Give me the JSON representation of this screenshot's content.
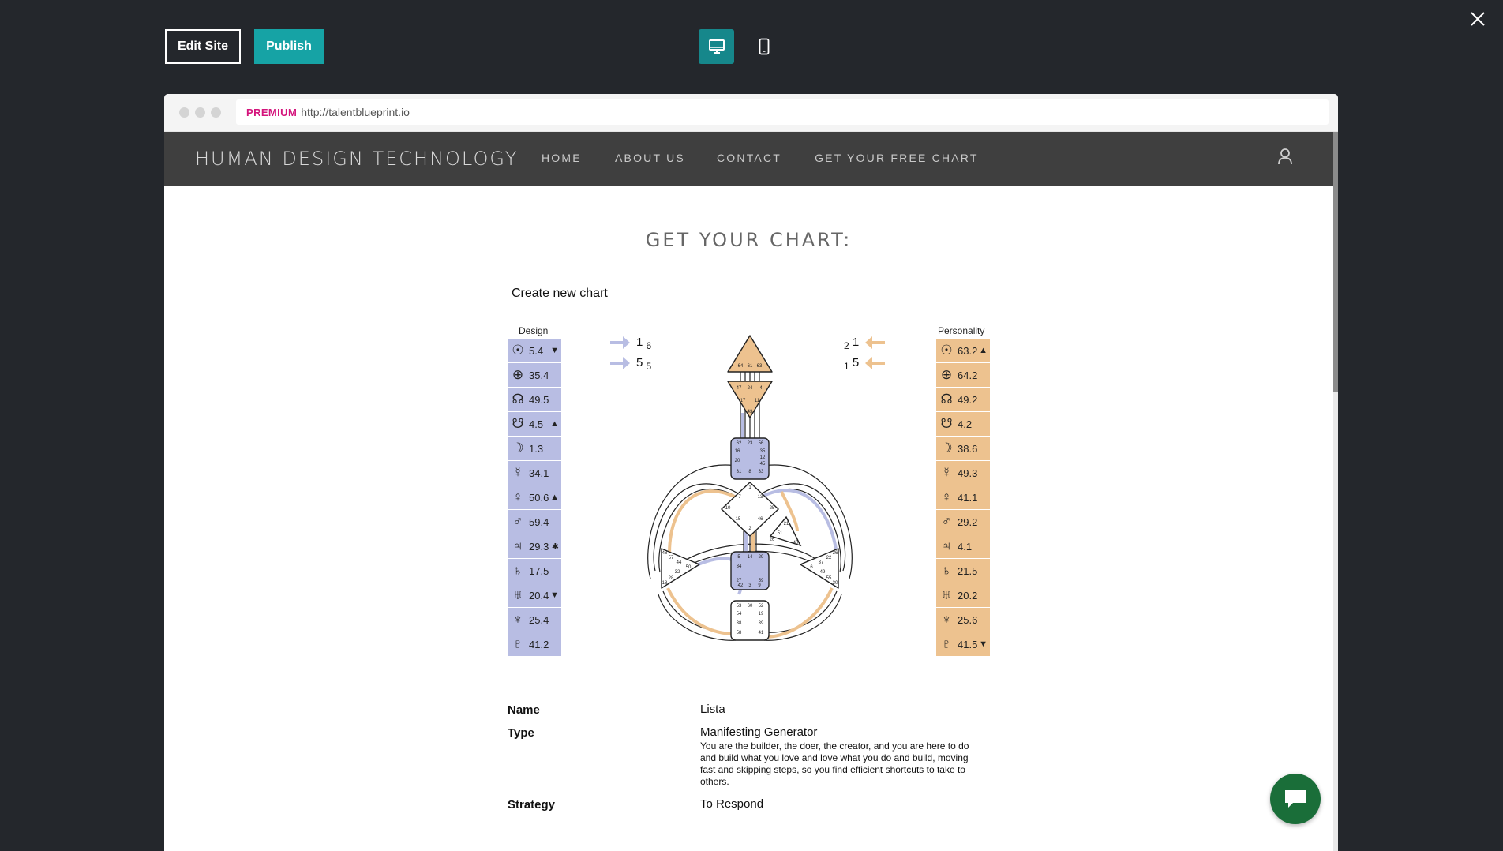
{
  "editor": {
    "edit_label": "Edit Site",
    "publish_label": "Publish",
    "desktop_icon": "desktop-icon",
    "mobile_icon": "mobile-icon",
    "close_icon": "close-icon"
  },
  "browser": {
    "badge": "PREMIUM",
    "url": "http://talentblueprint.io"
  },
  "site": {
    "brand": "HUMAN DESIGN TECHNOLOGY",
    "nav": [
      {
        "label": "HOME"
      },
      {
        "label": "ABOUT US"
      },
      {
        "label": "CONTACT"
      },
      {
        "label": "– GET YOUR FREE CHART"
      }
    ],
    "user_icon": "user-icon"
  },
  "page": {
    "title": "GET YOUR CHART:",
    "create_link": "Create new chart"
  },
  "chart": {
    "design_label": "Design",
    "personality_label": "Personality",
    "design": [
      {
        "planet": "sun",
        "symbol": "☉",
        "value": "5.4",
        "mark": "▼"
      },
      {
        "planet": "earth",
        "symbol": "⊕",
        "value": "35.4",
        "mark": ""
      },
      {
        "planet": "north-node",
        "symbol": "☊",
        "value": "49.5",
        "mark": ""
      },
      {
        "planet": "south-node",
        "symbol": "☋",
        "value": "4.5",
        "mark": "▲"
      },
      {
        "planet": "moon",
        "symbol": "☽",
        "value": "1.3",
        "mark": ""
      },
      {
        "planet": "mercury",
        "symbol": "☿",
        "value": "34.1",
        "mark": ""
      },
      {
        "planet": "venus",
        "symbol": "♀",
        "value": "50.6",
        "mark": "▲"
      },
      {
        "planet": "mars",
        "symbol": "♂",
        "value": "59.4",
        "mark": ""
      },
      {
        "planet": "jupiter",
        "symbol": "♃",
        "value": "29.3",
        "mark": "✱"
      },
      {
        "planet": "saturn",
        "symbol": "♄",
        "value": "17.5",
        "mark": ""
      },
      {
        "planet": "uranus",
        "symbol": "♅",
        "value": "20.4",
        "mark": "▼"
      },
      {
        "planet": "neptune",
        "symbol": "♆",
        "value": "25.4",
        "mark": ""
      },
      {
        "planet": "pluto",
        "symbol": "♇",
        "value": "41.2",
        "mark": ""
      }
    ],
    "personality": [
      {
        "planet": "sun",
        "symbol": "☉",
        "value": "63.2",
        "mark": "▲"
      },
      {
        "planet": "earth",
        "symbol": "⊕",
        "value": "64.2",
        "mark": ""
      },
      {
        "planet": "north-node",
        "symbol": "☊",
        "value": "49.2",
        "mark": ""
      },
      {
        "planet": "south-node",
        "symbol": "☋",
        "value": "4.2",
        "mark": ""
      },
      {
        "planet": "moon",
        "symbol": "☽",
        "value": "38.6",
        "mark": ""
      },
      {
        "planet": "mercury",
        "symbol": "☿",
        "value": "49.3",
        "mark": ""
      },
      {
        "planet": "venus",
        "symbol": "♀",
        "value": "41.1",
        "mark": ""
      },
      {
        "planet": "mars",
        "symbol": "♂",
        "value": "29.2",
        "mark": ""
      },
      {
        "planet": "jupiter",
        "symbol": "♃",
        "value": "4.1",
        "mark": ""
      },
      {
        "planet": "saturn",
        "symbol": "♄",
        "value": "21.5",
        "mark": ""
      },
      {
        "planet": "uranus",
        "symbol": "♅",
        "value": "20.2",
        "mark": ""
      },
      {
        "planet": "neptune",
        "symbol": "♆",
        "value": "25.6",
        "mark": ""
      },
      {
        "planet": "pluto",
        "symbol": "♇",
        "value": "41.5",
        "mark": "▼"
      }
    ],
    "left_arrows": [
      {
        "main": "1",
        "sub": "6"
      },
      {
        "main": "5",
        "sub": "5"
      }
    ],
    "right_arrows": [
      {
        "sub": "2",
        "main": "1"
      },
      {
        "sub": "1",
        "main": "5"
      }
    ],
    "gates": {
      "head": [
        "64",
        "61",
        "63"
      ],
      "ajna": [
        "47",
        "24",
        "4",
        "17",
        "11",
        "43"
      ],
      "throat": [
        "62",
        "23",
        "56",
        "16",
        "35",
        "20",
        "12",
        "45",
        "31",
        "8",
        "33"
      ],
      "g": [
        "1",
        "7",
        "13",
        "10",
        "25",
        "15",
        "46",
        "2"
      ],
      "heart": [
        "21",
        "51",
        "26",
        "40"
      ],
      "sacral": [
        "5",
        "14",
        "29",
        "34",
        "27",
        "59",
        "42",
        "3",
        "9"
      ],
      "spleen": [
        "48",
        "57",
        "44",
        "50",
        "32",
        "28",
        "18"
      ],
      "solar": [
        "36",
        "22",
        "37",
        "6",
        "49",
        "55",
        "30"
      ],
      "root": [
        "53",
        "60",
        "52",
        "54",
        "19",
        "38",
        "39",
        "58",
        "41"
      ]
    },
    "colors": {
      "design": "#b8bde3",
      "personality": "#edc28f",
      "arrow_design": "#b8bde3",
      "arrow_personality": "#edc28f"
    }
  },
  "info": {
    "name_label": "Name",
    "name_value": "Lista",
    "type_label": "Type",
    "type_value": "Manifesting Generator",
    "type_desc": "You are the builder, the doer, the creator, and you are here to do and build what you love and love what you do and build, moving fast and skipping steps, so you find efficient shortcuts to take to others.",
    "strategy_label": "Strategy",
    "strategy_value": "To Respond"
  },
  "chat": {
    "icon": "chat-icon"
  }
}
